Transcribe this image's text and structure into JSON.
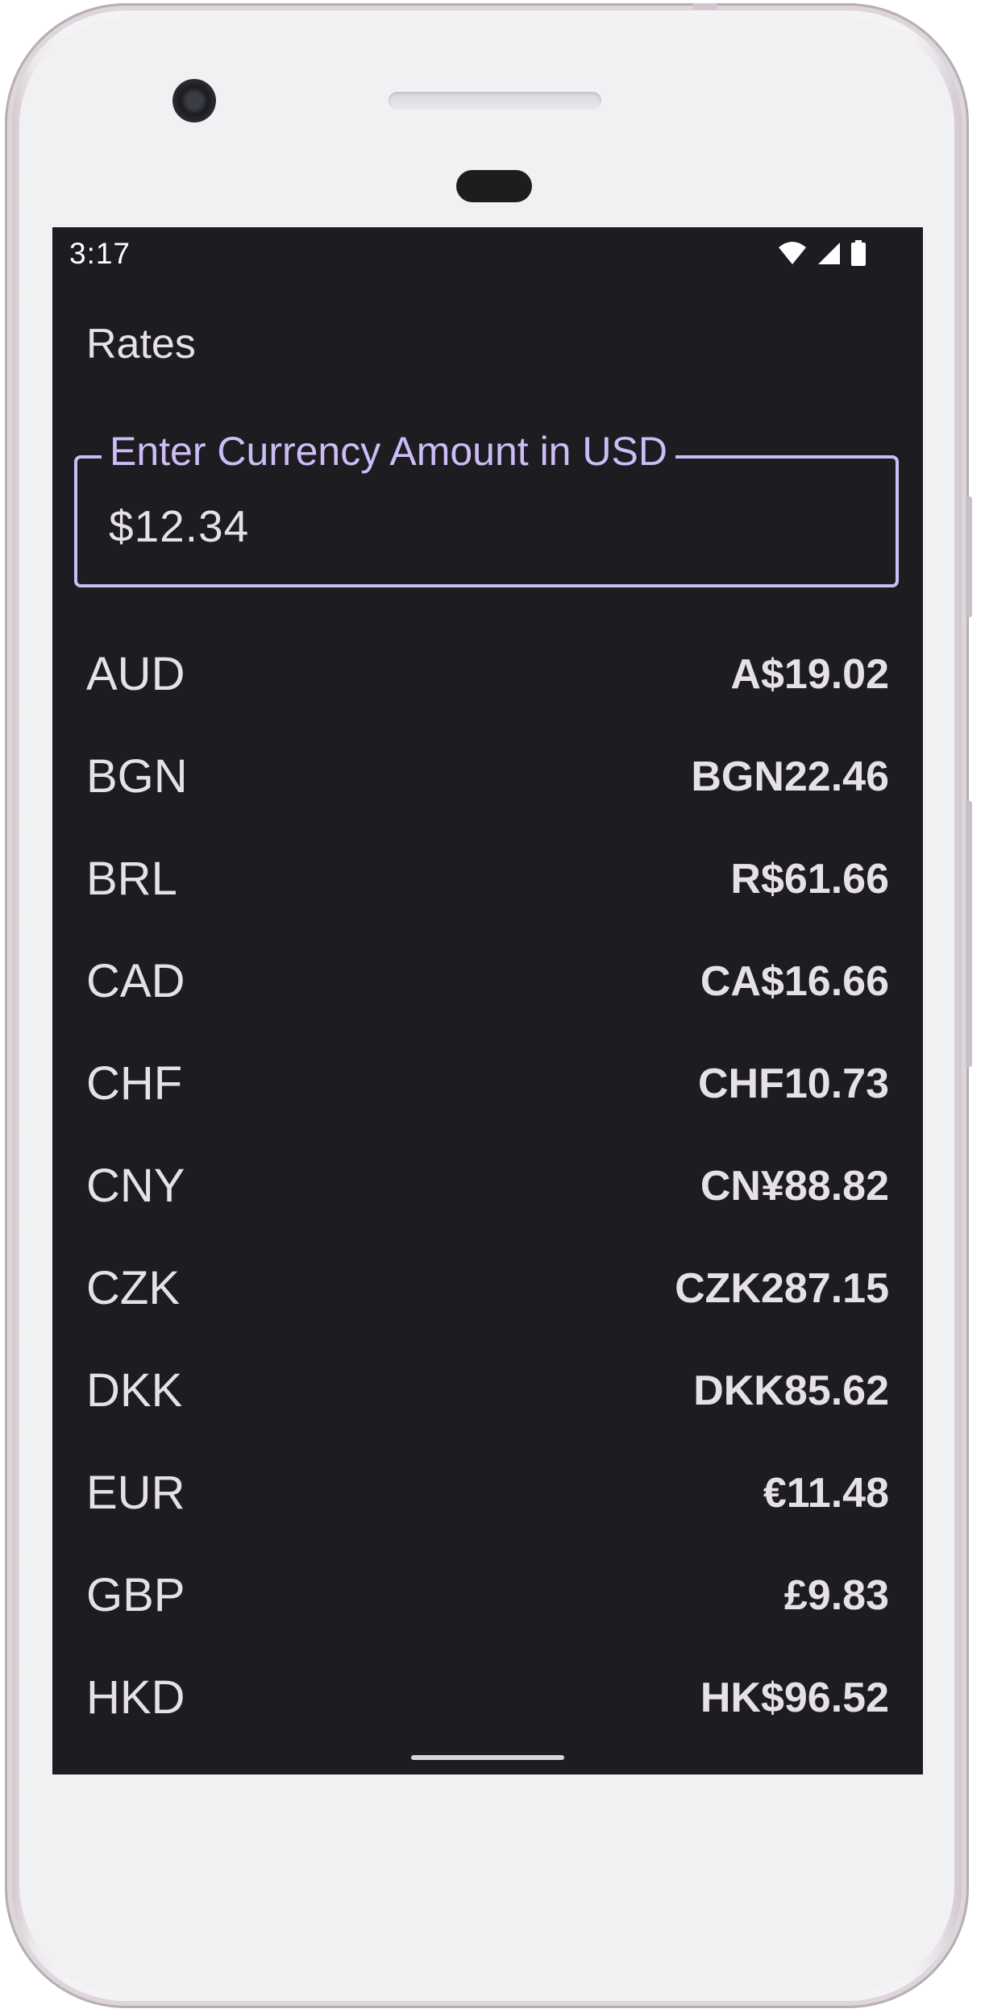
{
  "status_bar": {
    "time": "3:17",
    "icons": [
      "wifi-icon",
      "cell-signal-icon",
      "battery-icon"
    ]
  },
  "app": {
    "title": "Rates"
  },
  "amount_field": {
    "label": "Enter Currency Amount in USD",
    "value": "$12.34"
  },
  "rates": [
    {
      "code": "AUD",
      "amount": "A$19.02"
    },
    {
      "code": "BGN",
      "amount": "BGN22.46"
    },
    {
      "code": "BRL",
      "amount": "R$61.66"
    },
    {
      "code": "CAD",
      "amount": "CA$16.66"
    },
    {
      "code": "CHF",
      "amount": "CHF10.73"
    },
    {
      "code": "CNY",
      "amount": "CN¥88.82"
    },
    {
      "code": "CZK",
      "amount": "CZK287.15"
    },
    {
      "code": "DKK",
      "amount": "DKK85.62"
    },
    {
      "code": "EUR",
      "amount": "€11.48"
    },
    {
      "code": "GBP",
      "amount": "£9.83"
    },
    {
      "code": "HKD",
      "amount": "HK$96.52"
    }
  ],
  "colors": {
    "screen_background": "#1d1c21",
    "accent": "#cdbdf7",
    "text": "#e6e1e6"
  }
}
